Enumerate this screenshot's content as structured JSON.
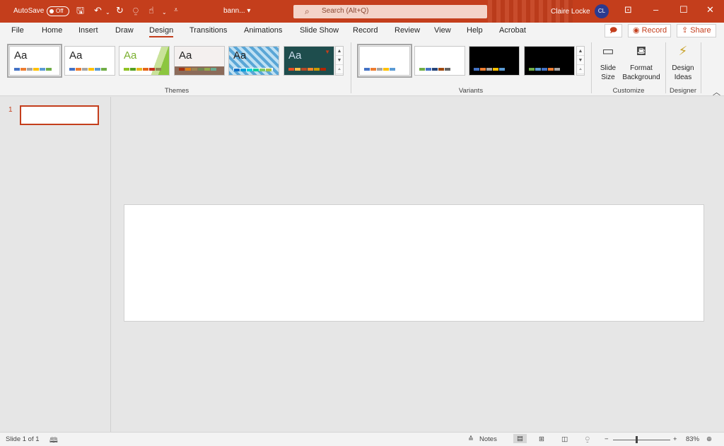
{
  "titlebar": {
    "autosave_label": "AutoSave",
    "autosave_state": "Off",
    "filename": "bann... ▾",
    "search_placeholder": "Search (Alt+Q)",
    "user_name": "Claire Locke",
    "user_initials": "CL"
  },
  "menu": {
    "items": [
      "File",
      "Home",
      "Insert",
      "Draw",
      "Design",
      "Transitions",
      "Animations",
      "Slide Show",
      "Record",
      "Review",
      "View",
      "Help",
      "Acrobat"
    ],
    "active": "Design",
    "record_label": "Record",
    "share_label": "Share"
  },
  "ribbon": {
    "themes_label": "Themes",
    "variants_label": "Variants",
    "customize_label": "Customize",
    "designer_label": "Designer",
    "theme_sample_text": "Aa",
    "slide_size_label": "Slide Size",
    "format_background_label": "Format Background",
    "design_ideas_label": "Design Ideas"
  },
  "slides_panel": {
    "slide_number": "1"
  },
  "statusbar": {
    "slide_info": "Slide 1 of 1",
    "notes_label": "Notes",
    "zoom_level": "83%"
  },
  "colors": {
    "brand": "#c43e1c",
    "ribbon_bg": "#f3f3f3",
    "canvas_bg": "#e6e6e6"
  }
}
